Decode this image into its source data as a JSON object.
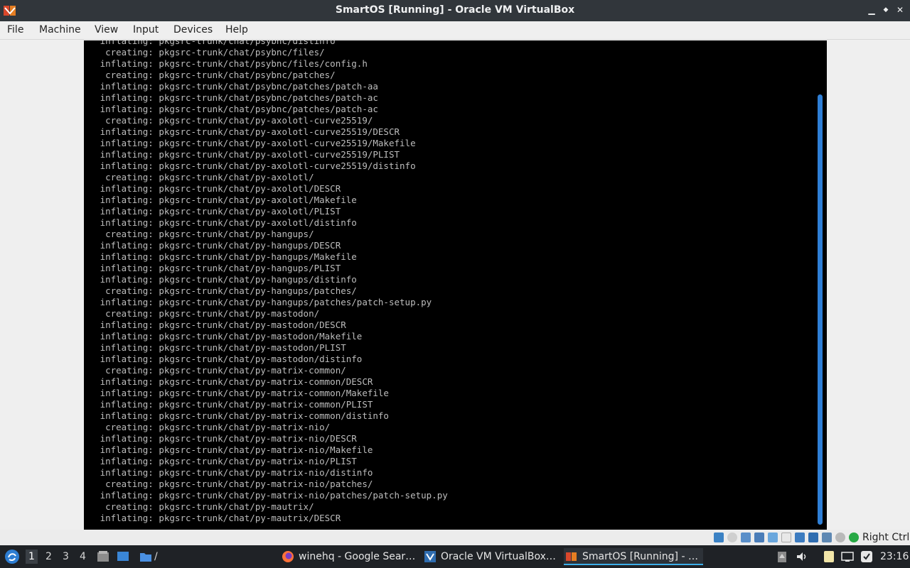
{
  "window": {
    "title": "SmartOS [Running] - Oracle VM VirtualBox",
    "minimize_glyph": "▁",
    "restore_glyph": "◆",
    "close_glyph": "✕"
  },
  "menu": [
    "File",
    "Machine",
    "View",
    "Input",
    "Devices",
    "Help"
  ],
  "console_lines": [
    "inflating: pkgsrc-trunk/chat/psybnc/distinfo",
    " creating: pkgsrc-trunk/chat/psybnc/files/",
    "inflating: pkgsrc-trunk/chat/psybnc/files/config.h",
    " creating: pkgsrc-trunk/chat/psybnc/patches/",
    "inflating: pkgsrc-trunk/chat/psybnc/patches/patch-aa",
    "inflating: pkgsrc-trunk/chat/psybnc/patches/patch-ac",
    "inflating: pkgsrc-trunk/chat/psybnc/patches/patch-ac",
    " creating: pkgsrc-trunk/chat/py-axolotl-curve25519/",
    "inflating: pkgsrc-trunk/chat/py-axolotl-curve25519/DESCR",
    "inflating: pkgsrc-trunk/chat/py-axolotl-curve25519/Makefile",
    "inflating: pkgsrc-trunk/chat/py-axolotl-curve25519/PLIST",
    "inflating: pkgsrc-trunk/chat/py-axolotl-curve25519/distinfo",
    " creating: pkgsrc-trunk/chat/py-axolotl/",
    "inflating: pkgsrc-trunk/chat/py-axolotl/DESCR",
    "inflating: pkgsrc-trunk/chat/py-axolotl/Makefile",
    "inflating: pkgsrc-trunk/chat/py-axolotl/PLIST",
    "inflating: pkgsrc-trunk/chat/py-axolotl/distinfo",
    " creating: pkgsrc-trunk/chat/py-hangups/",
    "inflating: pkgsrc-trunk/chat/py-hangups/DESCR",
    "inflating: pkgsrc-trunk/chat/py-hangups/Makefile",
    "inflating: pkgsrc-trunk/chat/py-hangups/PLIST",
    "inflating: pkgsrc-trunk/chat/py-hangups/distinfo",
    " creating: pkgsrc-trunk/chat/py-hangups/patches/",
    "inflating: pkgsrc-trunk/chat/py-hangups/patches/patch-setup.py",
    " creating: pkgsrc-trunk/chat/py-mastodon/",
    "inflating: pkgsrc-trunk/chat/py-mastodon/DESCR",
    "inflating: pkgsrc-trunk/chat/py-mastodon/Makefile",
    "inflating: pkgsrc-trunk/chat/py-mastodon/PLIST",
    "inflating: pkgsrc-trunk/chat/py-mastodon/distinfo",
    " creating: pkgsrc-trunk/chat/py-matrix-common/",
    "inflating: pkgsrc-trunk/chat/py-matrix-common/DESCR",
    "inflating: pkgsrc-trunk/chat/py-matrix-common/Makefile",
    "inflating: pkgsrc-trunk/chat/py-matrix-common/PLIST",
    "inflating: pkgsrc-trunk/chat/py-matrix-common/distinfo",
    " creating: pkgsrc-trunk/chat/py-matrix-nio/",
    "inflating: pkgsrc-trunk/chat/py-matrix-nio/DESCR",
    "inflating: pkgsrc-trunk/chat/py-matrix-nio/Makefile",
    "inflating: pkgsrc-trunk/chat/py-matrix-nio/PLIST",
    "inflating: pkgsrc-trunk/chat/py-matrix-nio/distinfo",
    " creating: pkgsrc-trunk/chat/py-matrix-nio/patches/",
    "inflating: pkgsrc-trunk/chat/py-matrix-nio/patches/patch-setup.py",
    " creating: pkgsrc-trunk/chat/py-mautrix/",
    "inflating: pkgsrc-trunk/chat/py-mautrix/DESCR"
  ],
  "statusbar": {
    "host_key": "Right Ctrl"
  },
  "taskbar": {
    "workspaces": [
      "1",
      "2",
      "3",
      "4"
    ],
    "active_workspace": "1",
    "folder_label": "/",
    "tasks": [
      "winehq - Google Sear…",
      "Oracle VM VirtualBox…",
      "SmartOS [Running] - …"
    ],
    "clock": "23:16"
  },
  "colors": {
    "titlebar": "#31363b",
    "console_bg": "#000000",
    "console_fg": "#bdbdbd",
    "scrollbar": "#2f7fd6",
    "taskbar": "#1f2226"
  }
}
